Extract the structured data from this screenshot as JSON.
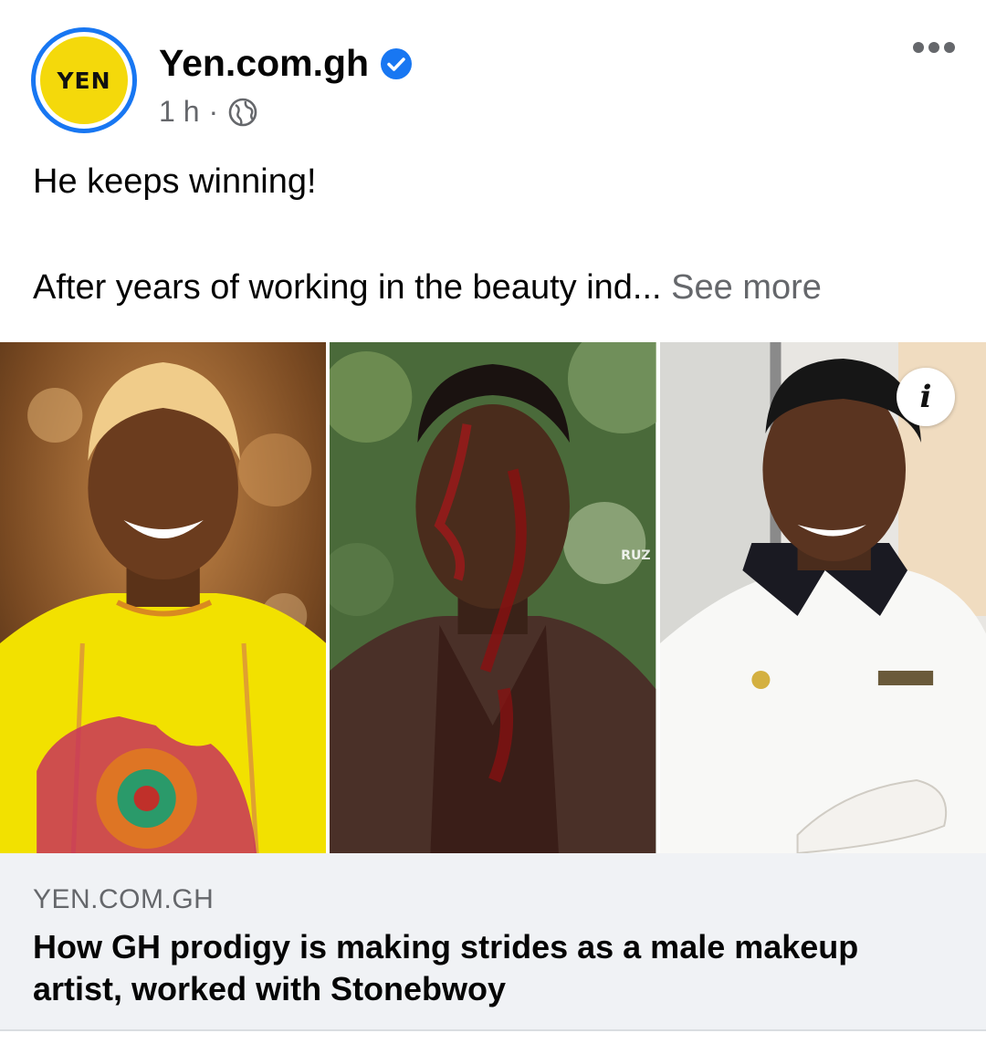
{
  "post": {
    "avatar_text": "YEN",
    "page_name": "Yen.com.gh",
    "time": "1 h",
    "separator": "·",
    "text_line1": "He keeps winning!",
    "text_line2": "After years of working in the beauty ind...",
    "see_more": "See more"
  },
  "media": {
    "info_label": "i",
    "watermark": "RUZ"
  },
  "link_card": {
    "domain": "YEN.COM.GH",
    "title": "How GH prodigy is making strides as a male makeup artist, worked with Stonebwoy"
  },
  "icons": [
    "verified-badge-icon",
    "globe-icon",
    "more-options-icon",
    "info-icon"
  ],
  "colors": {
    "accent": "#1877f2",
    "avatar_yellow": "#f4d90b",
    "secondary_text": "#65676b",
    "card_bg": "#f0f2f5"
  }
}
